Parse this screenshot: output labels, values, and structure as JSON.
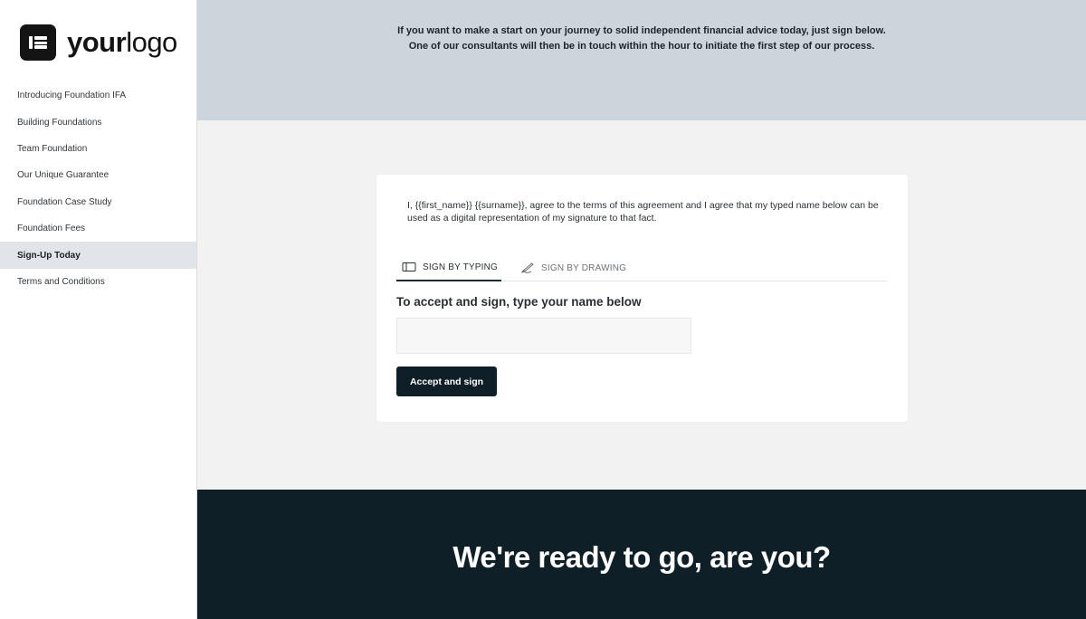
{
  "sidebar": {
    "logo": {
      "text_bold": "your",
      "text_regular": "logo"
    },
    "items": [
      {
        "label": "Introducing Foundation IFA"
      },
      {
        "label": "Building Foundations"
      },
      {
        "label": "Team Foundation"
      },
      {
        "label": "Our Unique Guarantee"
      },
      {
        "label": "Foundation Case Study"
      },
      {
        "label": "Foundation Fees"
      },
      {
        "label": "Sign-Up Today",
        "active": true
      },
      {
        "label": "Terms and Conditions"
      }
    ]
  },
  "header": {
    "line1": "If you want to make a start on your journey to solid independent financial advice today, just sign below.",
    "line2": "One of our consultants will then be in touch within the hour to initiate the first step of our process."
  },
  "signature_card": {
    "agreement_text": "I, {{first_name}} {{surname}}, agree to the terms of this agreement and I agree that my typed name below can be used as a digital representation of my signature to that fact.",
    "tabs": [
      {
        "label": "SIGN BY TYPING",
        "icon": "keyboard-icon",
        "active": true
      },
      {
        "label": "SIGN BY DRAWING",
        "icon": "pen-icon",
        "active": false
      }
    ],
    "instruction": "To accept and sign, type your name below",
    "name_input": {
      "value": "",
      "placeholder": ""
    },
    "accept_button": "Accept and sign"
  },
  "footer": {
    "heading": "We're ready to go, are you?"
  },
  "colors": {
    "header_band": "#cdd5dc",
    "main_background": "#f2f2f2",
    "footer_band": "#0f1f28",
    "button": "#0f1f28",
    "active_nav": "#e1e4e9"
  }
}
